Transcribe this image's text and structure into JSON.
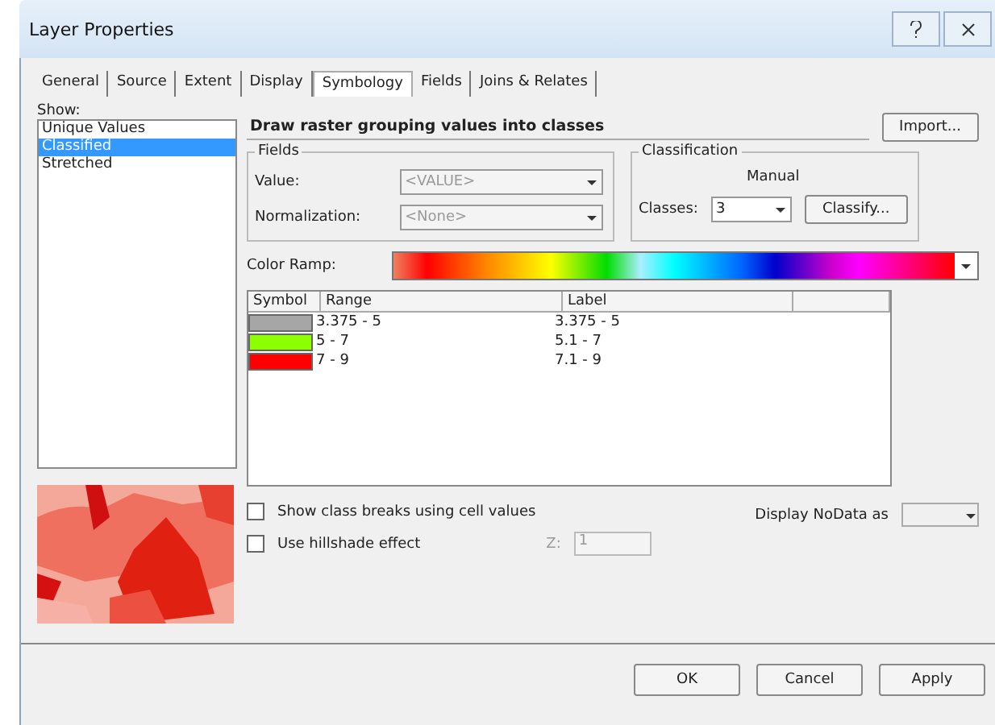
{
  "window": {
    "title": "Layer Properties"
  },
  "tabs": [
    {
      "label": "General",
      "selected": false
    },
    {
      "label": "Source",
      "selected": false
    },
    {
      "label": "Extent",
      "selected": false
    },
    {
      "label": "Display",
      "selected": false
    },
    {
      "label": "Symbology",
      "selected": true
    },
    {
      "label": "Fields",
      "selected": false
    },
    {
      "label": "Joins & Relates",
      "selected": false
    }
  ],
  "show": {
    "label": "Show:",
    "items": [
      {
        "label": "Unique Values",
        "selected": false
      },
      {
        "label": "Classified",
        "selected": true
      },
      {
        "label": "Stretched",
        "selected": false
      }
    ]
  },
  "heading": "Draw raster grouping values into classes",
  "import_button": "Import...",
  "fields": {
    "title": "Fields",
    "disabled": true,
    "value_label": "Value:",
    "value": "<VALUE>",
    "normalization_label": "Normalization:",
    "normalization": "<None>"
  },
  "classification": {
    "title": "Classification",
    "method": "Manual",
    "classes_label": "Classes:",
    "classes": "3",
    "classify_button": "Classify..."
  },
  "color_ramp": {
    "label": "Color Ramp:"
  },
  "table": {
    "columns": [
      "Symbol",
      "Range",
      "Label"
    ],
    "rows": [
      {
        "color": "#a6a6a6",
        "range": "3.375 - 5",
        "label": "3.375 - 5"
      },
      {
        "color": "#8cff00",
        "range": "5 - 7",
        "label": "5.1 - 7"
      },
      {
        "color": "#ff0000",
        "range": "7 - 9",
        "label": "7.1 - 9"
      }
    ]
  },
  "options": [
    {
      "label": "Show class breaks using cell values",
      "checked": false
    },
    {
      "label": "Use hillshade effect",
      "checked": false
    }
  ],
  "z": {
    "label": "Z:",
    "value": "1",
    "disabled": true
  },
  "nodata": {
    "label": "Display NoData as"
  },
  "buttons": [
    "OK",
    "Cancel",
    "Apply"
  ]
}
